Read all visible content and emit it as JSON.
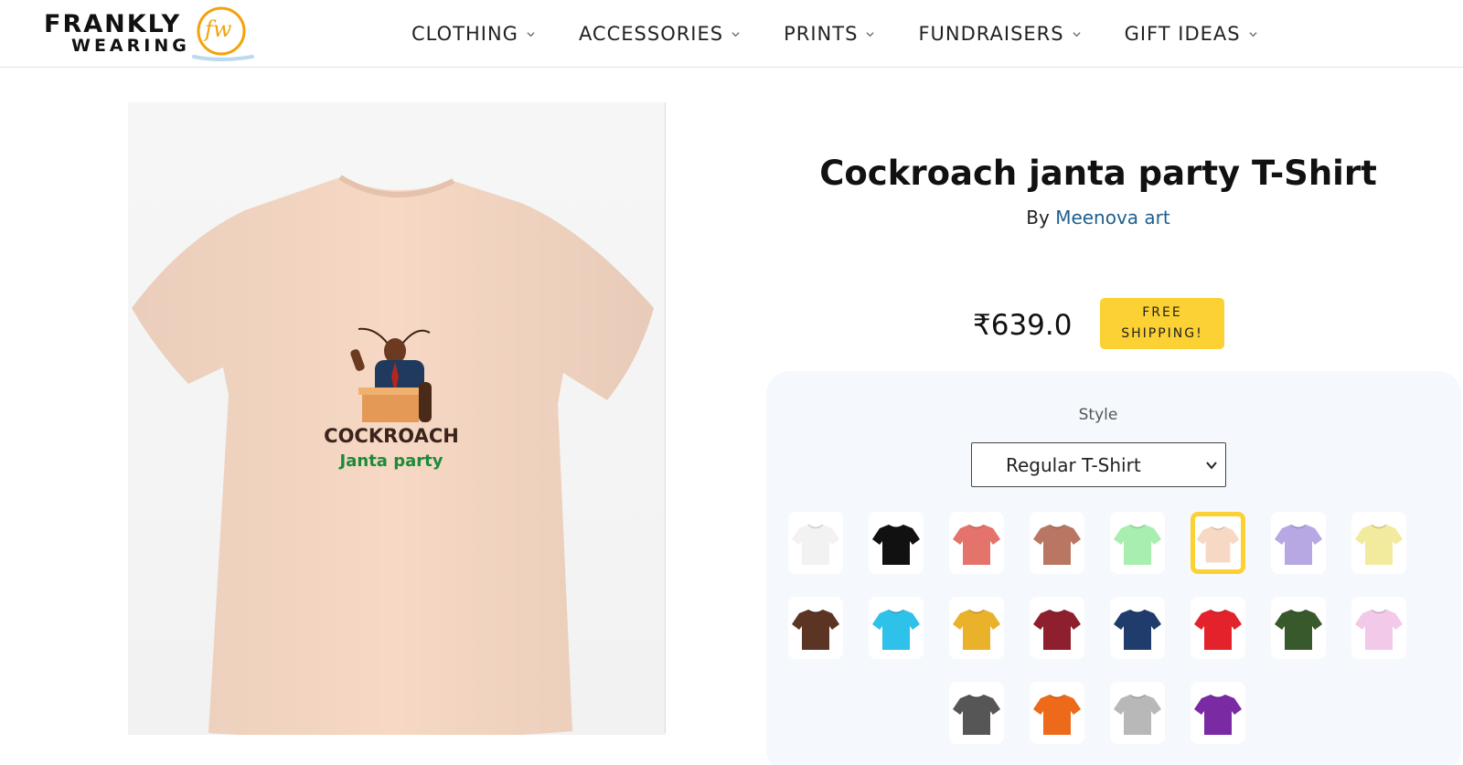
{
  "header": {
    "logo": {
      "line1": "FRANKLY",
      "line2": "WEARING",
      "mark": "fw"
    },
    "nav": [
      {
        "label": "CLOTHING"
      },
      {
        "label": "ACCESSORIES"
      },
      {
        "label": "PRINTS"
      },
      {
        "label": "FUNDRAISERS"
      },
      {
        "label": "GIFT IDEAS"
      }
    ]
  },
  "product": {
    "title": "Cockroach janta party T-Shirt",
    "by_prefix": "By",
    "artist": "Meenova art",
    "price": "₹639.0",
    "shipping_badge": "FREE\nSHIPPING!",
    "image": {
      "shirt_color": "#f6d8c4",
      "print_line1": "COCKROACH",
      "print_line2": "Janta party"
    },
    "style_label": "Style",
    "style_selected": "Regular T-Shirt",
    "colors": [
      {
        "hex": "#f2f2f2",
        "selected": false
      },
      {
        "hex": "#111111",
        "selected": false
      },
      {
        "hex": "#e4746b",
        "selected": false
      },
      {
        "hex": "#b97763",
        "selected": false
      },
      {
        "hex": "#a8eeb0",
        "selected": false
      },
      {
        "hex": "#f6d8c4",
        "selected": true
      },
      {
        "hex": "#b7a7e2",
        "selected": false
      },
      {
        "hex": "#f2ea9c",
        "selected": false
      },
      {
        "hex": "#5b3423",
        "selected": false
      },
      {
        "hex": "#2ec1ea",
        "selected": false
      },
      {
        "hex": "#eab12b",
        "selected": false
      },
      {
        "hex": "#8e1f2c",
        "selected": false
      },
      {
        "hex": "#1f3c6c",
        "selected": false
      },
      {
        "hex": "#e3222b",
        "selected": false
      },
      {
        "hex": "#38592c",
        "selected": false
      },
      {
        "hex": "#f2c9e8",
        "selected": false
      },
      {
        "hex": "#565656",
        "selected": false
      },
      {
        "hex": "#ec6a1a",
        "selected": false
      },
      {
        "hex": "#b8b8b8",
        "selected": false
      },
      {
        "hex": "#7a2ba3",
        "selected": false
      }
    ]
  },
  "icons": {
    "nav_chevron": "chevron-down-icon",
    "select_chevron": "chevron-down-icon",
    "logo_mark": "fw-circle-logo"
  },
  "colors": {
    "accent_yellow": "#fcd133",
    "link_blue": "#1f5f8e",
    "panel_bg": "#f5f8fc"
  }
}
